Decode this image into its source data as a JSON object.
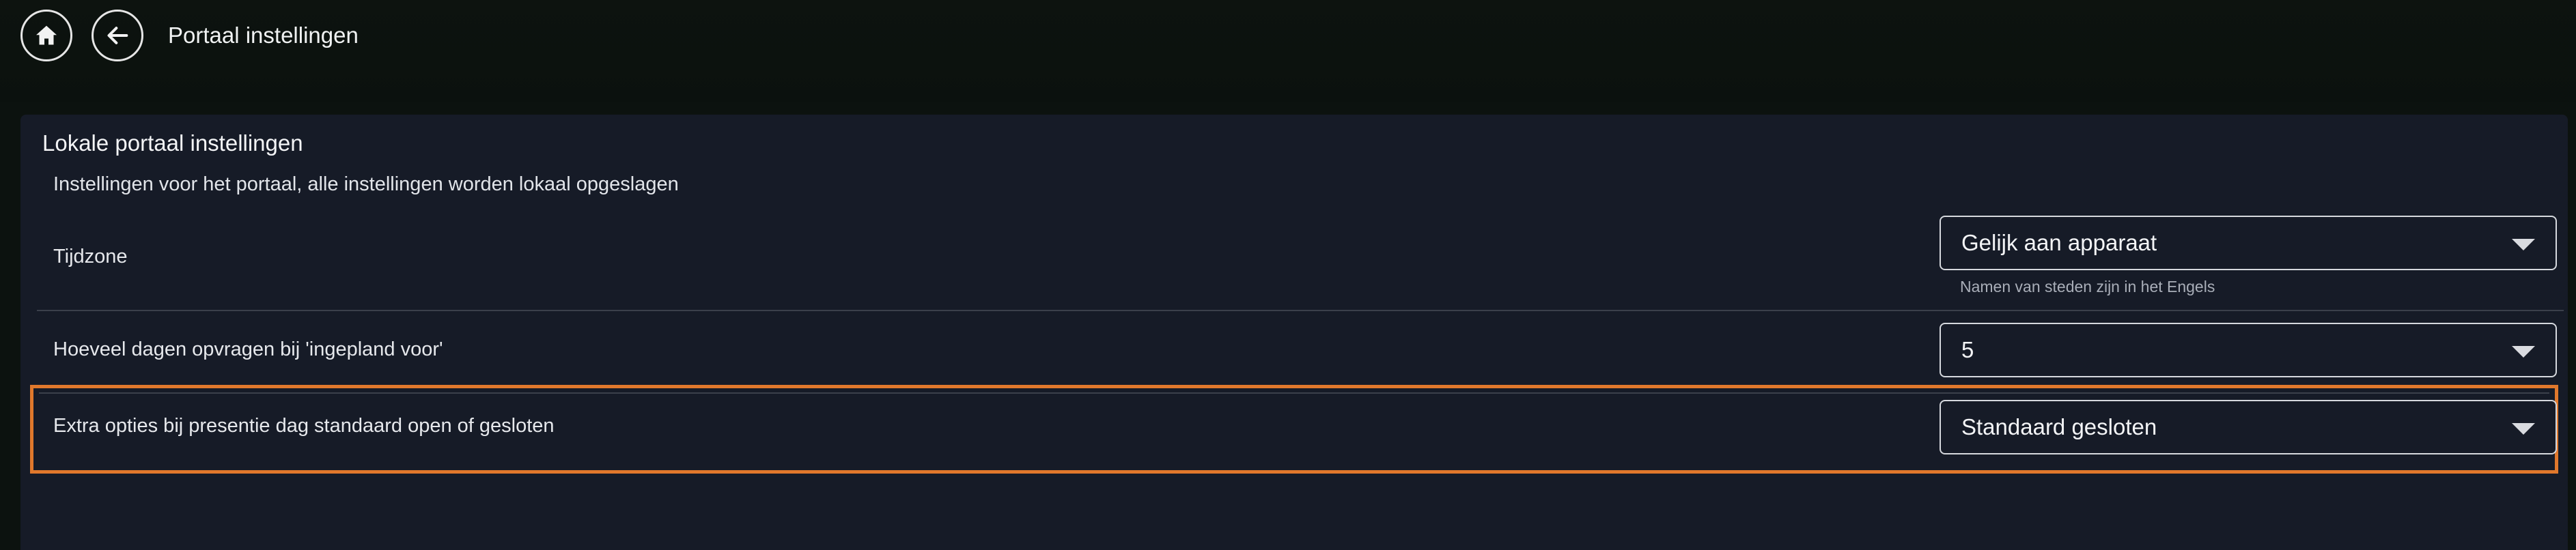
{
  "header": {
    "title": "Portaal instellingen",
    "home_icon": "home-icon",
    "back_icon": "arrow-left-icon"
  },
  "card": {
    "title": "Lokale portaal instellingen",
    "description": "Instellingen voor het portaal, alle instellingen worden lokaal opgeslagen",
    "rows": [
      {
        "label": "Tijdzone",
        "value": "Gelijk aan apparaat",
        "helper": "Namen van steden zijn in het Engels"
      },
      {
        "label": "Hoeveel dagen opvragen bij 'ingepland voor'",
        "value": "5"
      },
      {
        "label": "Extra opties bij presentie dag standaard open of gesloten",
        "value": "Standaard gesloten"
      }
    ]
  },
  "colors": {
    "background": "#0c120f",
    "card": "#161b27",
    "highlight": "#e0782c"
  }
}
